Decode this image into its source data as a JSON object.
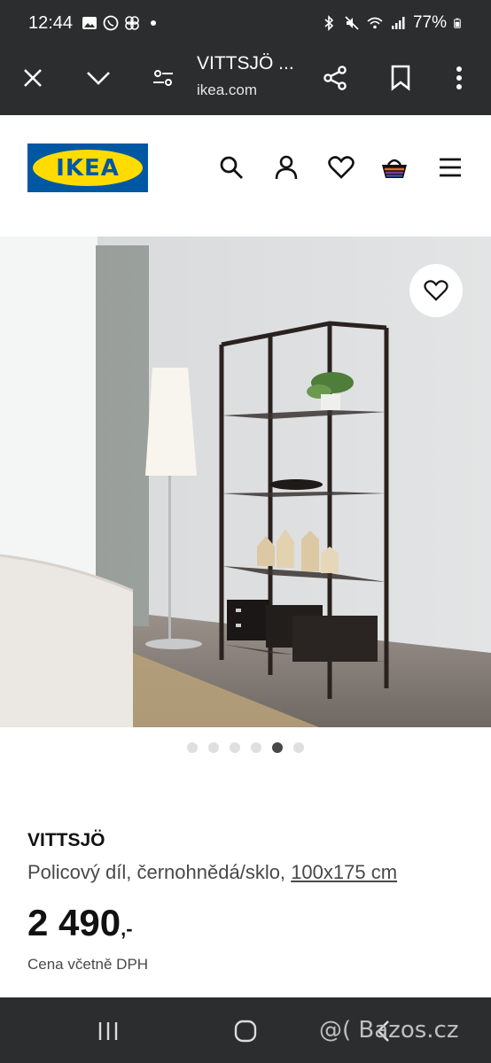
{
  "status_bar": {
    "time": "12:44",
    "battery": "77%"
  },
  "browser": {
    "title": "VITTSJÖ ...",
    "url": "ikea.com"
  },
  "header": {
    "logo_text": "IKEA",
    "brand_blue": "#0058a3",
    "brand_yellow": "#ffdb00"
  },
  "gallery": {
    "slide_count": 6,
    "active_index": 4
  },
  "product": {
    "name": "VITTSJÖ",
    "description": "Policový díl, černohnědá/sklo,",
    "dimensions": "100x175 cm",
    "price_main": "2 490",
    "price_suffix": ",-",
    "vat_note": "Cena včetně DPH"
  },
  "watermark": "@( Bazos.cz"
}
